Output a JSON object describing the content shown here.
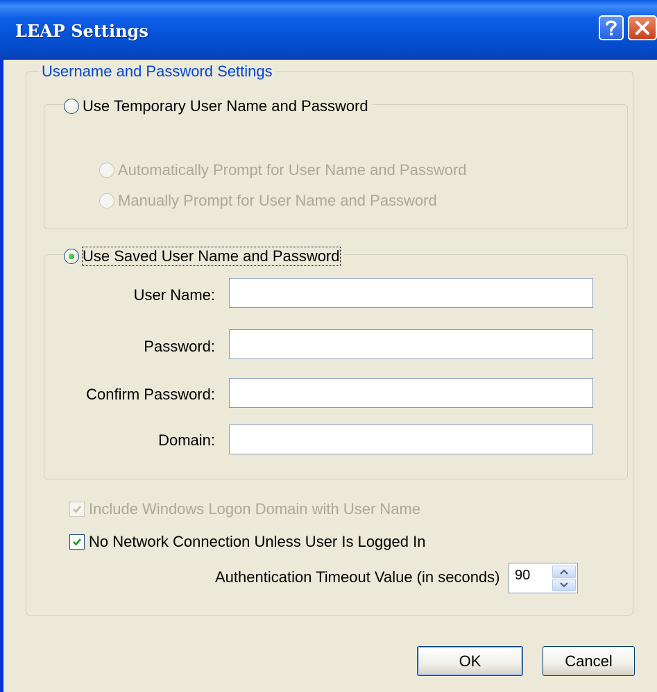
{
  "window": {
    "title": "LEAP Settings",
    "help_icon": "question-mark-icon",
    "close_icon": "close-x-icon"
  },
  "group_main": {
    "legend": "Username and Password Settings"
  },
  "temporary": {
    "label": "Use Temporary User Name and Password",
    "selected": false,
    "options": [
      {
        "label": "Automatically Prompt for User Name and Password",
        "enabled": false
      },
      {
        "label": "Manually Prompt for User Name and Password",
        "enabled": false
      }
    ]
  },
  "saved": {
    "label": "Use Saved User Name and Password",
    "selected": true,
    "fields": {
      "user_name": {
        "label": "User Name:",
        "value": ""
      },
      "password": {
        "label": "Password:",
        "value": ""
      },
      "confirm_password": {
        "label": "Confirm Password:",
        "value": ""
      },
      "domain": {
        "label": "Domain:",
        "value": ""
      }
    }
  },
  "checkboxes": {
    "include_domain": {
      "label": "Include Windows Logon Domain with User Name",
      "checked": true,
      "enabled": false
    },
    "no_network": {
      "label": "No Network Connection Unless User Is Logged In",
      "checked": true,
      "enabled": true
    }
  },
  "timeout": {
    "label": "Authentication Timeout Value (in seconds)",
    "value": "90"
  },
  "buttons": {
    "ok": "OK",
    "cancel": "Cancel"
  },
  "colors": {
    "title_bar": "#0552d6",
    "legend_text": "#0046d5",
    "dialog_bg": "#ece9d8",
    "check_mark": "#21a121"
  }
}
